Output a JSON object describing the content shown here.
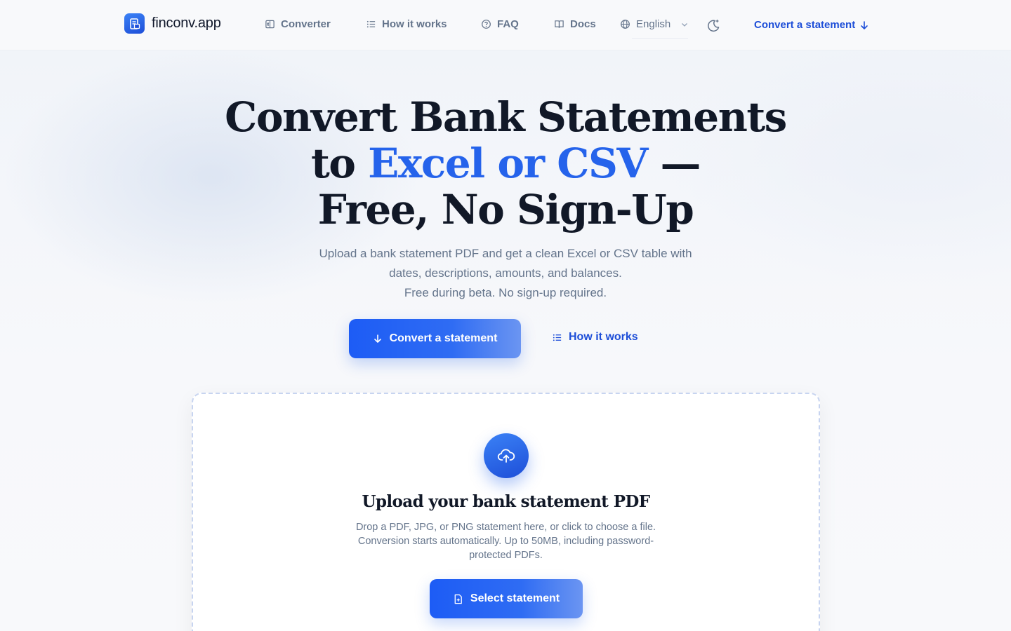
{
  "brand": {
    "name": "finconv.app",
    "logo_icon": "document-logo-icon"
  },
  "nav": {
    "items": [
      {
        "label": "Converter",
        "icon": "spreadsheet-icon"
      },
      {
        "label": "How it works",
        "icon": "list-icon"
      },
      {
        "label": "FAQ",
        "icon": "help-circle-icon"
      },
      {
        "label": "Docs",
        "icon": "book-icon"
      }
    ],
    "language": {
      "selected": "English",
      "icon": "globe-icon"
    },
    "theme_toggle_icon": "moon-sparkle-icon",
    "cta_label": "Convert a statement"
  },
  "hero": {
    "headline_line1": "Convert Bank Statements",
    "headline_line2_prefix": "to ",
    "headline_line2_accent": "Excel or CSV",
    "headline_line2_suffix": " —",
    "headline_line3": "Free, No Sign-Up",
    "subtitle_line1": "Upload a bank statement PDF and get a clean Excel or CSV table with",
    "subtitle_line2": "dates, descriptions, amounts, and balances.",
    "subtitle_line3": "Free during beta. No sign-up required.",
    "primary_button": "Convert a statement",
    "secondary_link": "How it works"
  },
  "upload": {
    "title": "Upload your bank statement PDF",
    "description": "Drop a PDF, JPG, or PNG statement here, or click to choose a file. Conversion starts automatically. Up to 50MB, including password-protected PDFs.",
    "button_label": "Select statement",
    "icon": "cloud-upload-icon"
  },
  "colors": {
    "accent": "#2563eb",
    "accent_dark": "#1d4ed8",
    "text": "#111827",
    "muted": "#64748b",
    "background": "#f7f8fb"
  }
}
